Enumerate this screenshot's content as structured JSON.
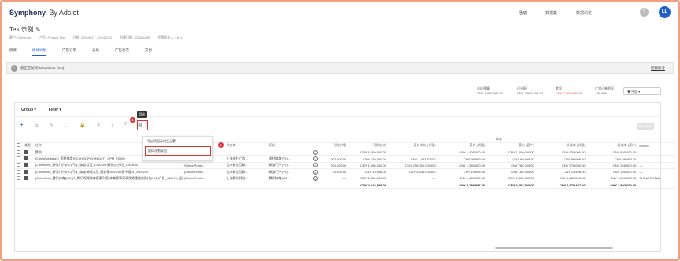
{
  "header": {
    "brand": "Symphony.",
    "brand_by": "By Adslot",
    "nav": [
      "活动",
      "数据集",
      "数据浏览"
    ],
    "help": "?",
    "avatar": "LL"
  },
  "page": {
    "title": "Test示例 ✎",
    "meta": [
      "客户: China test",
      "产品: Product Test",
      "日期: 2025/6/17 - 2024/2/22",
      "创建日期: 2025/10/05",
      "代理联系人: Lily Li"
    ],
    "tabs": [
      "摘要",
      "媒体计划",
      "广告订单",
      "表格",
      "广告发布",
      "交付"
    ],
    "active_tab": "媒体计划"
  },
  "banner": {
    "info": "i",
    "text": "您正在访问 Mindshare (CN)",
    "switch": "切换账号"
  },
  "summary": {
    "budget_label": "总体预算",
    "budget_value": "CNY 1,000,000.00",
    "spent_label": "已分配",
    "spent_value": "CNY 2,503,600.00",
    "remain_label": "差异",
    "remain_value": "CNY -1,503,600.00",
    "ratio_label": "广告订单利率",
    "ratio_value": "-39.09%",
    "currency": "中国"
  },
  "toolbar": {
    "group_label": "Group ▾",
    "filter_label": "Filter ▾",
    "tooltip": "导出",
    "save_label": "确认计划",
    "badge1": "1",
    "badge2": "2",
    "menu_items": [
      "导出项目计划至元素",
      "媒体计划导出"
    ]
  },
  "table": {
    "group_header": "成本",
    "headers": [
      "类型",
      "名称",
      "",
      "供应商",
      "网站",
      "",
      "刊例价格",
      "刊例价/价",
      "基价单价 (代理)",
      "基价 (代理)",
      "基价 (客户)",
      "总成本 (代理)",
      "总成本 (客户)",
      "Market"
    ],
    "rows": [
      [
        "赞助",
        "(China Publis...",
        "—",
        "—",
        "—",
        "CNY 1,400,000.00",
        "—",
        "CNY 1,400,000.00",
        "CNY 1,400,000.00",
        "CNY 630,000.00",
        "CNY 630,000.00",
        "—"
      ],
      [
        "(ChinaPublisher)_虎扑体育(PC)(HOOPCHINA)(IT)_CPM_75000",
        "(China Publis...",
        "上海虎扑广告...",
        "虎扑体育(PC)...",
        "000.00000",
        "CNY 120,000.00",
        "CNY 1,333.32000",
        "CNY 99,999.00",
        "CNY 99,999.10",
        "CNY 89,999.10",
        "CNY 89,999.10",
        "—"
      ],
      [
        "(ChinaPubl_新浪门户(PC)汽车_体育首页_1000*300双拼(4小时)_1000x30",
        "(China Publis...",
        "北京新浪互联...",
        "新浪门户(PC)...",
        "000.00000",
        "CNY 1,280,000.00",
        "CNY 256,000.000000",
        "CNY 1,280,000.00",
        "CNY 768,000.00",
        "CNY 576,000.00",
        "CNY 345,600.00",
        "—"
      ],
      [
        "(ChinaPubl_新浪门户(PC)汽车_体育新闻内页_两轮播300*250画中画01_300x250",
        "(China Publis...",
        "北京新浪互联...",
        "新浪门户(PC)...",
        "33.00000",
        "CNY 19,998.00",
        "CNY 3,333.000000",
        "CNY 19,998.00",
        "CNY 165,500.00",
        "CNY 14,498.00",
        "CNY 160,000.00",
        "—"
      ],
      [
        "(ChinaPubl_腾讯体育(MO)(T_腾讯视频体育赛事列表/体育赛事列表视频播放前贴片(BVB)广告_480x70_全国通投",
        "(China Publis...",
        "上海腾讯科技...",
        "腾讯体育(MO...",
        "—",
        "CNY 1,400,000.00",
        "—",
        "CNY 1,400,000.00",
        "CNY 1,400,000.00",
        "CNY 1,260,000.00",
        "CNY 1,260,000.00",
        "CHINA CHINA"
      ]
    ],
    "totals": [
      "CNY 4,219,998.00",
      "CNY 4,199,997.00",
      "CNY 3,853,500.00",
      "CNY 2,570,497.10",
      "CNY 2,503,600.00"
    ]
  }
}
